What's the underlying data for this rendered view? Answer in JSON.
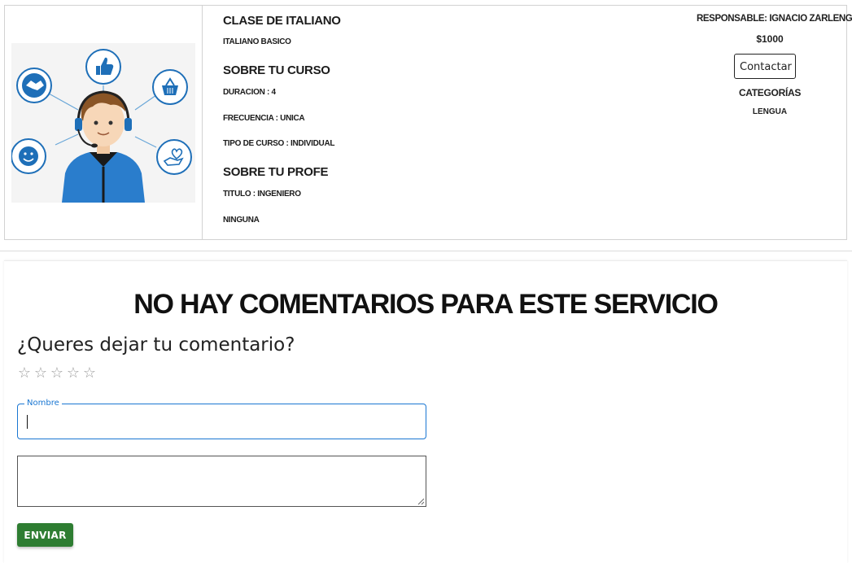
{
  "service": {
    "title": "CLASE DE ITALIANO",
    "subtitle": "ITALIANO BASICO",
    "course_heading": "SOBRE TU CURSO",
    "duration": "DURACION : 4",
    "frequency": "FRECUENCIA : UNICA",
    "course_type": "TIPO DE CURSO : INDIVIDUAL",
    "teacher_heading": "SOBRE TU PROFE",
    "teacher_title": "TITULO : INGENIERO",
    "teacher_extra": "NINGUNA"
  },
  "sidebar": {
    "responsible": "RESPONSABLE: IGNACIO ZARLENGA",
    "price": "$1000",
    "contact_label": "Contactar",
    "categories_heading": "CATEGORÍAS",
    "category": "LENGUA"
  },
  "comments": {
    "empty_message": "NO HAY COMENTARIOS PARA ESTE SERVICIO",
    "prompt": "¿Queres dejar tu comentario?",
    "stars": [
      "☆",
      "☆",
      "☆",
      "☆",
      "☆"
    ],
    "rating": 0,
    "name_label": "Nombre",
    "name_value": "",
    "comment_value": "",
    "send_label": "ENVIAR"
  },
  "colors": {
    "accent_blue": "#1976d2",
    "send_green": "#2e7d32",
    "star_grey": "#9e9e9e"
  },
  "icons": {
    "illustration": "customer-support-agent-illustration",
    "bubbles": [
      "handshake-icon",
      "thumbs-up-icon",
      "basket-icon",
      "smiley-icon",
      "hand-heart-icon"
    ]
  }
}
